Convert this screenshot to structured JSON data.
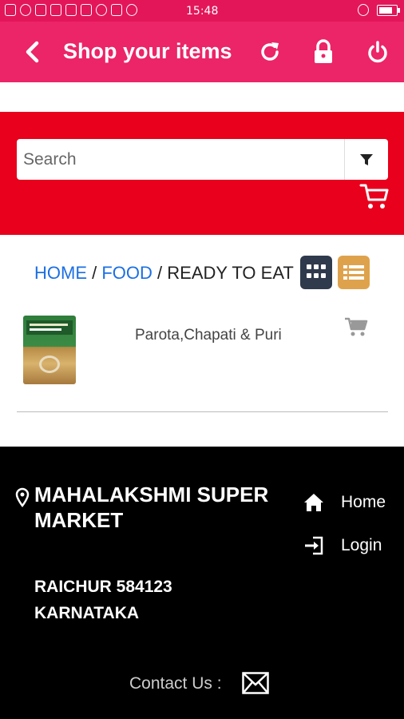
{
  "status_bar": {
    "time": "15:48"
  },
  "app_bar": {
    "title": "Shop your items",
    "icons": [
      "back-icon",
      "refresh-icon",
      "lock-icon",
      "power-icon"
    ]
  },
  "search": {
    "placeholder": "Search",
    "value": "",
    "icons": [
      "filter-icon",
      "cart-icon"
    ]
  },
  "breadcrumb": {
    "home": "HOME",
    "food": "FOOD",
    "current": "READY TO EAT",
    "separator": "/"
  },
  "products": [
    {
      "name": "Parota,Chapati & Puri",
      "icon": "cart-icon"
    }
  ],
  "footer": {
    "store_name": "MAHALAKSHMI SUPER MARKET",
    "address_line1": "RAICHUR 584123",
    "address_line2": "KARNATAKA",
    "nav": [
      {
        "label": "Home",
        "icon": "home-icon"
      },
      {
        "label": "Login",
        "icon": "login-icon"
      }
    ],
    "contact_label": "Contact Us :",
    "contact_icon": "mail-icon"
  },
  "colors": {
    "status_bar": "#e3165a",
    "app_bar": "#ec2468",
    "search_banner": "#e8001c",
    "link": "#1c6fe3",
    "grid_toggle": "#2f3a4c",
    "list_toggle": "#dfa24c",
    "footer": "#000000"
  }
}
